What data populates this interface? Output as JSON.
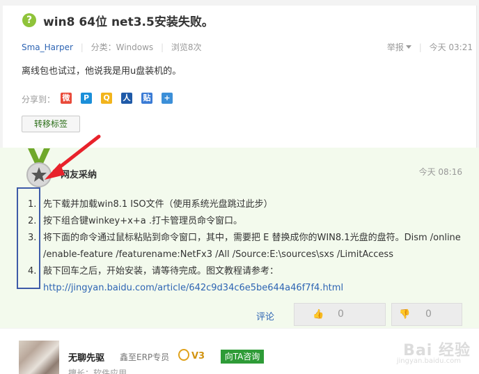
{
  "question": {
    "icon_symbol": "?",
    "title": "win8 64位 net3.5安装失败。",
    "meta": {
      "user": "Sma_Harper",
      "category": "分类：Windows",
      "views": "浏览8次",
      "report": "举报",
      "time": "今天 03:21"
    },
    "description": "离线包也试过，他说我是用u盘装机的。",
    "share_label": "分享到：",
    "share_icons": [
      "weibo-icon",
      "qzone-p-icon",
      "qq-space-icon",
      "renren-icon",
      "tieba-icon",
      "plus-icon"
    ],
    "share_glyphs": [
      "微",
      "P",
      "Q",
      "人",
      "贴",
      "+"
    ],
    "move_tag_button": "转移标签"
  },
  "answer": {
    "adopted_label": "网友采纳",
    "time": "今天 08:16",
    "steps": [
      {
        "num": "1.",
        "text": "先下载并加载win8.1 ISO文件（使用系统光盘跳过此步）"
      },
      {
        "num": "2.",
        "text": "按下组合键winkey+x+a .打卡管理员命令窗口。"
      },
      {
        "num": "3.",
        "text": "将下面的命令通过鼠标粘贴到命令窗口，其中，需要把 E 替换成你的WIN8.1光盘的盘符。Dism /online /enable-feature /featurename:NetFx3 /All /Source:E:\\sources\\sxs /LimitAccess"
      },
      {
        "num": "4.",
        "text": "敲下回车之后，开始安装，请等待完成。图文教程请参考：",
        "link": "http://jingyan.baidu.com/article/642c9d34c6e5be644a46f7f4.html"
      }
    ],
    "comment_label": "评论",
    "upvotes": "0",
    "downvotes": "0"
  },
  "user": {
    "name": "无聊先驱",
    "title": "鑫至ERP专员",
    "level": "V3",
    "consult_button": "向TA咨询",
    "specialty": "擅长：软件应用"
  },
  "watermark": {
    "main": "Bai 经验",
    "sub": "jingyan.baidu.com"
  }
}
